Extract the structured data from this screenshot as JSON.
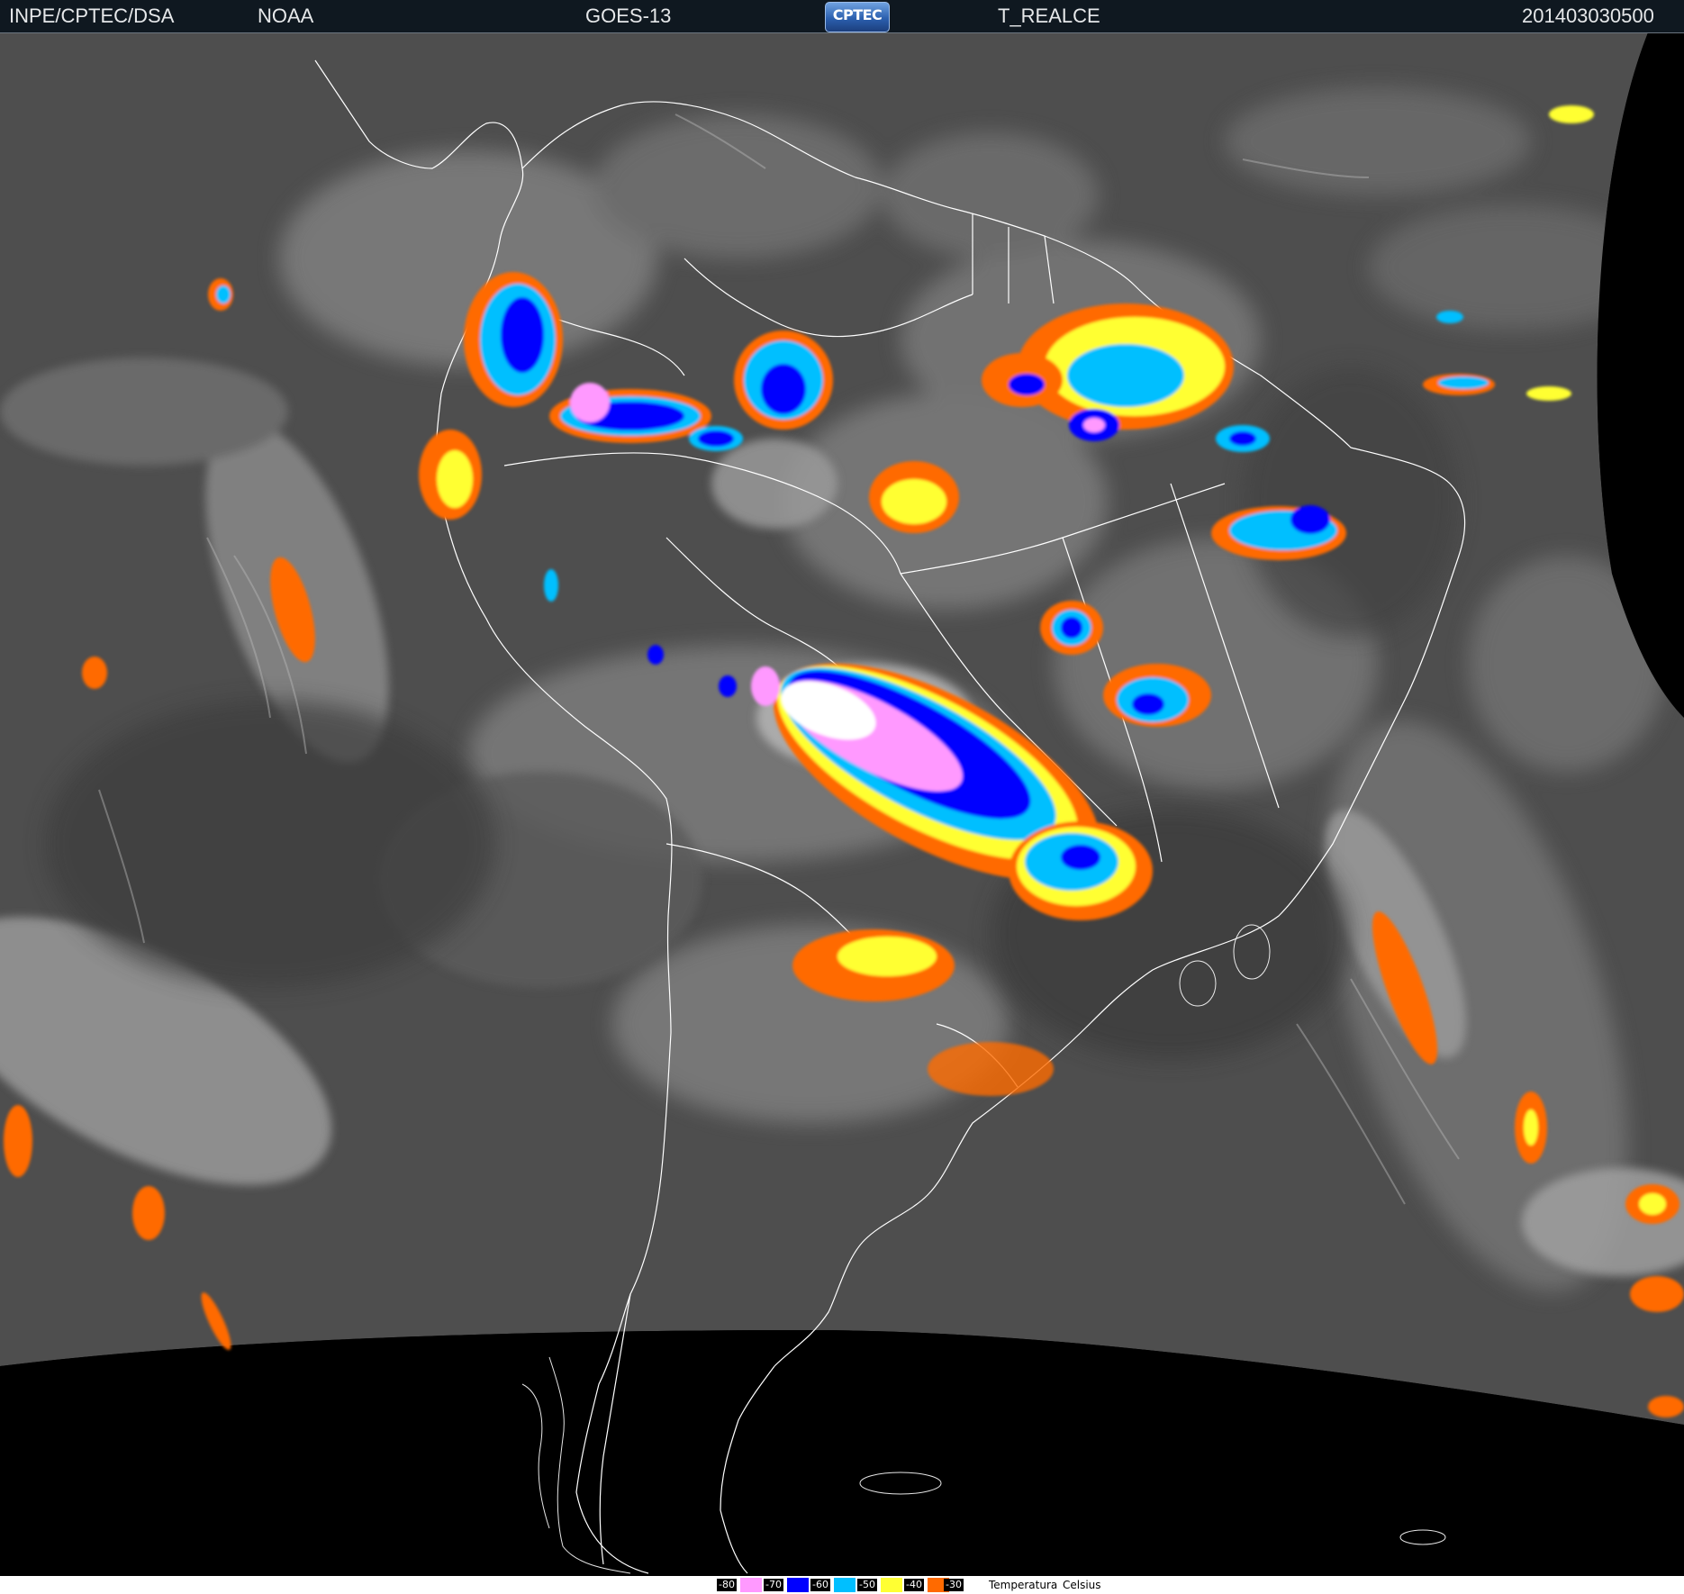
{
  "header": {
    "institution": "INPE/CPTEC/DSA",
    "agency": "NOAA",
    "satellite": "GOES-13",
    "logo_text": "CPTEC",
    "product": "T_REALCE",
    "timestamp": "201403030500"
  },
  "legend": {
    "entries": [
      {
        "value": "-80",
        "color": "#ff99ff"
      },
      {
        "value": "-70",
        "color": "#0000ff"
      },
      {
        "value": "-60",
        "color": "#00bfff"
      },
      {
        "value": "-50",
        "color": "#ffff33"
      },
      {
        "value": "-40",
        "color": "#ff6a00"
      },
      {
        "value": "-30",
        "color": "#ff6a00"
      }
    ],
    "label_1": "Temperatura",
    "label_2": "Celsius"
  },
  "colors": {
    "space": "#000000",
    "header_bg": "#0f1820",
    "coastline": "#ffffff",
    "cold_-80": "#ff99ff",
    "cold_-70": "#0000ff",
    "cold_-60": "#00bfff",
    "cold_-50": "#ffff33",
    "cold_-40": "#ff6a00"
  }
}
